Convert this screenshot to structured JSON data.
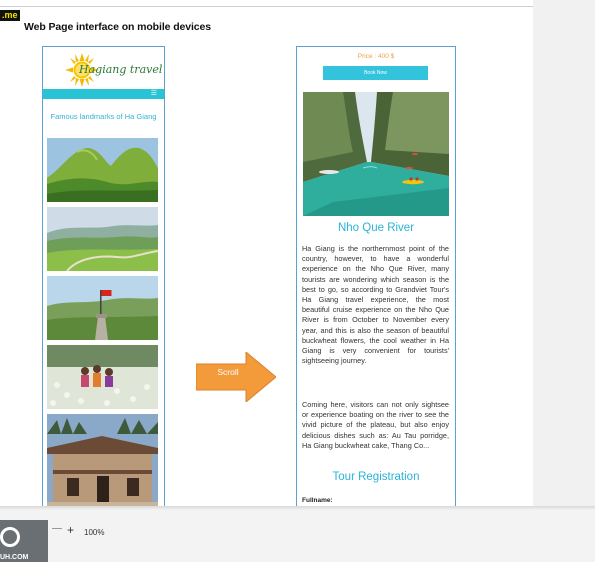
{
  "corner_tag": ".me",
  "doc_heading": "Web Page interface on mobile devices",
  "phone1": {
    "logo_text": "Hagiang travel",
    "menu_icon": "menu-icon",
    "landmark_title": "Famous landmarks of Ha Giang",
    "photos": [
      "twin-hills-photo",
      "valley-road-photo",
      "flag-tower-photo",
      "children-flowers-photo",
      "old-house-photo"
    ]
  },
  "arrow_label": "Scroll",
  "phone2": {
    "price": "Price : 400 $",
    "book_button": "Book Now",
    "river_title": "Nho Que River",
    "paragraph1": "Ha Giang is the northernmost point of the country, however, to have a wonderful experience on the Nho Que River, many tourists are wondering which season is the best to go, so according to Grandviet Tour's Ha Giang travel experience, the most beautiful cruise experience on the Nho Que River is from October to November every year, and this is also the season of beautiful buckwheat flowers, the cool weather in Ha Giang is very convenient for tourists' sightseeing journey.",
    "paragraph2": "Coming here, visitors can not only sightsee or experience boating on the river to see the vivid picture of the plateau, but also enjoy delicious dishes such as: Au Tau porridge, Ha Giang buckwheat cake, Thang Co...",
    "tour_title": "Tour Registration",
    "fullname_label": "Fullname:"
  },
  "bottom_bar": {
    "zoom_plus": "+",
    "zoom_value": "100%",
    "watermark_text": "UH.COM"
  },
  "colors": {
    "accent": "#2ab3d6",
    "menubar": "#28c4d6",
    "price": "#f0a04a",
    "arrow": "#f39a3a",
    "frame": "#5aa2cf"
  }
}
